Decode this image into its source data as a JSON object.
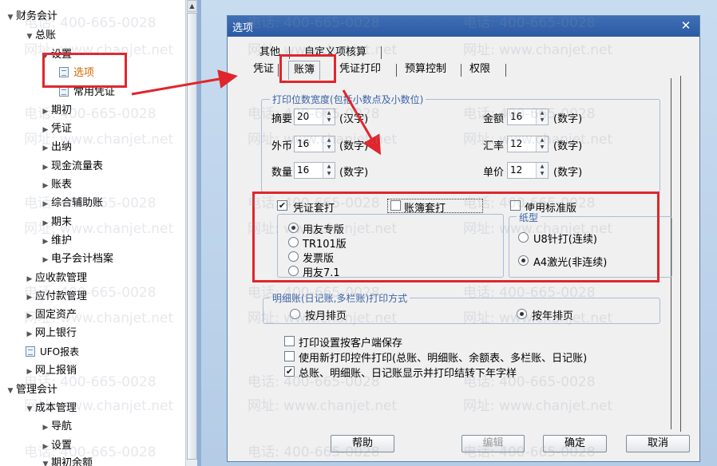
{
  "tree": {
    "items": [
      {
        "label": "财务会计",
        "toggle": "▼",
        "icon": "none"
      },
      {
        "label": "总账",
        "toggle": "▼",
        "icon": "none"
      },
      {
        "label": "设置",
        "toggle": "▼",
        "icon": "none"
      },
      {
        "label": "选项",
        "toggle": "",
        "icon": "document-icon"
      },
      {
        "label": "常用凭证",
        "toggle": "",
        "icon": "document-icon"
      },
      {
        "label": "期初",
        "toggle": "▶",
        "icon": "none"
      },
      {
        "label": "凭证",
        "toggle": "▶",
        "icon": "none"
      },
      {
        "label": "出纳",
        "toggle": "▶",
        "icon": "none"
      },
      {
        "label": "现金流量表",
        "toggle": "▶",
        "icon": "none"
      },
      {
        "label": "账表",
        "toggle": "▶",
        "icon": "none"
      },
      {
        "label": "综合辅助账",
        "toggle": "▶",
        "icon": "none"
      },
      {
        "label": "期末",
        "toggle": "▶",
        "icon": "none"
      },
      {
        "label": "维护",
        "toggle": "▶",
        "icon": "none"
      },
      {
        "label": "电子会计档案",
        "toggle": "▶",
        "icon": "none"
      },
      {
        "label": "应收款管理",
        "toggle": "▶",
        "icon": "none"
      },
      {
        "label": "应付款管理",
        "toggle": "▶",
        "icon": "none"
      },
      {
        "label": "固定资产",
        "toggle": "▶",
        "icon": "none"
      },
      {
        "label": "网上银行",
        "toggle": "▶",
        "icon": "none"
      },
      {
        "label": "UFO报表",
        "toggle": "",
        "icon": "document-icon"
      },
      {
        "label": "网上报销",
        "toggle": "▶",
        "icon": "none"
      },
      {
        "label": "管理会计",
        "toggle": "▼",
        "icon": "none"
      },
      {
        "label": "成本管理",
        "toggle": "▼",
        "icon": "none"
      },
      {
        "label": "导航",
        "toggle": "▶",
        "icon": "none"
      },
      {
        "label": "设置",
        "toggle": "▶",
        "icon": "none"
      },
      {
        "label": "期初余额",
        "toggle": "▼",
        "icon": "none"
      }
    ],
    "scroll_up": "▲"
  },
  "watermark": {
    "phone": "电话: 400-665-0028",
    "site": "网址: www.chanjet.net"
  },
  "dialog": {
    "title": "选项",
    "close": "✕",
    "tabs_row1": [
      "其他",
      "自定义项核算"
    ],
    "tabs_row2": [
      "凭证",
      "账簿",
      "凭证打印",
      "预算控制",
      "权限"
    ],
    "print_width": {
      "legend": "打印位数宽度(包括小数点及小数位)",
      "fields": [
        {
          "label": "摘要",
          "value": "20",
          "unit": "(汉字)"
        },
        {
          "label": "外币",
          "value": "16",
          "unit": "(数字)"
        },
        {
          "label": "数量",
          "value": "16",
          "unit": "(数字)"
        },
        {
          "label": "金额",
          "value": "16",
          "unit": "(数字)"
        },
        {
          "label": "汇率",
          "value": "12",
          "unit": "(数字)"
        },
        {
          "label": "单价",
          "value": "12",
          "unit": "(数字)"
        }
      ]
    },
    "voucher_print": {
      "label": "凭证套打",
      "checked": true,
      "options": [
        "用友专版",
        "TR101版",
        "发票版",
        "用友7.1"
      ],
      "selected": "用友专版"
    },
    "ledger_print": {
      "label": "账簿套打",
      "checked": false
    },
    "standard_edition": {
      "label": "使用标准版",
      "checked": false
    },
    "paper_type": {
      "legend": "纸型",
      "options": [
        "U8针打(连续)",
        "A4激光(非连续)"
      ],
      "selected": "A4激光(非连续)"
    },
    "detail_print": {
      "legend": "明细账(日记账,多栏账)打印方式",
      "options": [
        "按月排页",
        "按年排页"
      ],
      "selected": "按年排页"
    },
    "checkboxes": [
      {
        "label": "打印设置按客户端保存",
        "checked": false
      },
      {
        "label": "使用新打印控件打印(总账、明细账、余额表、多栏账、日记账)",
        "checked": false
      },
      {
        "label": "总账、明细账、日记账显示并打印结转下年字样",
        "checked": true
      }
    ],
    "buttons": {
      "help": "帮助",
      "edit": "编辑",
      "ok": "确定",
      "cancel": "取消"
    },
    "check_mark": "✔"
  },
  "annotation_color": "#e0262c"
}
